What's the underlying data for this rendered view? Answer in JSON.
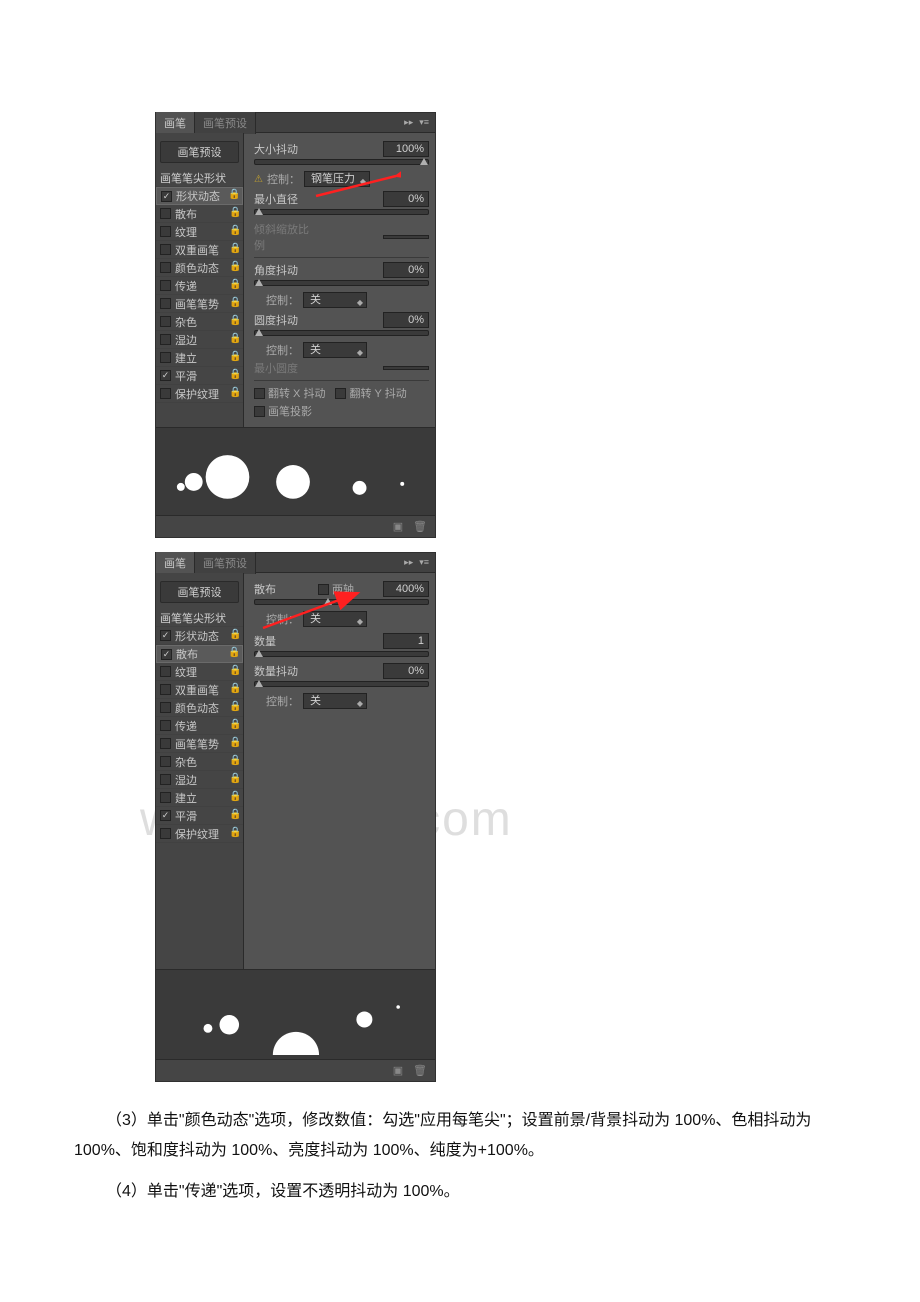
{
  "watermark": "www.bdocx.com",
  "panel1": {
    "tabs": {
      "active": "画笔",
      "inactive": "画笔预设"
    },
    "sidebar": {
      "btn": "画笔预设",
      "header": "画笔笔尖形状",
      "items": [
        {
          "label": "形状动态",
          "checked": true,
          "locked": true,
          "selected": true
        },
        {
          "label": "散布",
          "checked": false,
          "locked": true
        },
        {
          "label": "纹理",
          "checked": false,
          "locked": true
        },
        {
          "label": "双重画笔",
          "checked": false,
          "locked": true
        },
        {
          "label": "颜色动态",
          "checked": false,
          "locked": true
        },
        {
          "label": "传递",
          "checked": false,
          "locked": true
        },
        {
          "label": "画笔笔势",
          "checked": false,
          "locked": true
        },
        {
          "label": "杂色",
          "checked": false,
          "locked": true
        },
        {
          "label": "湿边",
          "checked": false,
          "locked": true
        },
        {
          "label": "建立",
          "checked": false,
          "locked": true
        },
        {
          "label": "平滑",
          "checked": true,
          "locked": true
        },
        {
          "label": "保护纹理",
          "checked": false,
          "locked": true
        }
      ]
    },
    "content": {
      "size_jitter_label": "大小抖动",
      "size_jitter_value": "100%",
      "control_label": "控制：",
      "control_dropdown": "钢笔压力",
      "min_diameter_label": "最小直径",
      "min_diameter_value": "0%",
      "tilt_scale_label": "倾斜缩放比例",
      "angle_jitter_label": "角度抖动",
      "angle_jitter_value": "0%",
      "angle_control_label": "控制：",
      "angle_control_value": "关",
      "round_jitter_label": "圆度抖动",
      "round_jitter_value": "0%",
      "round_control_label": "控制：",
      "round_control_value": "关",
      "min_round_label": "最小圆度",
      "flip_x_label": "翻转 X 抖动",
      "flip_y_label": "翻转 Y 抖动",
      "brush_proj_label": "画笔投影"
    }
  },
  "panel2": {
    "tabs": {
      "active": "画笔",
      "inactive": "画笔预设"
    },
    "sidebar": {
      "btn": "画笔预设",
      "header": "画笔笔尖形状",
      "items": [
        {
          "label": "形状动态",
          "checked": true,
          "locked": true
        },
        {
          "label": "散布",
          "checked": true,
          "locked": true,
          "lockred": true,
          "selected": true
        },
        {
          "label": "纹理",
          "checked": false,
          "locked": true
        },
        {
          "label": "双重画笔",
          "checked": false,
          "locked": true
        },
        {
          "label": "颜色动态",
          "checked": false,
          "locked": true
        },
        {
          "label": "传递",
          "checked": false,
          "locked": true
        },
        {
          "label": "画笔笔势",
          "checked": false,
          "locked": true
        },
        {
          "label": "杂色",
          "checked": false,
          "locked": true
        },
        {
          "label": "湿边",
          "checked": false,
          "locked": true
        },
        {
          "label": "建立",
          "checked": false,
          "locked": true
        },
        {
          "label": "平滑",
          "checked": true,
          "locked": true
        },
        {
          "label": "保护纹理",
          "checked": false,
          "locked": true
        }
      ]
    },
    "content": {
      "scatter_label": "散布",
      "both_axes_label": "两轴",
      "scatter_value": "400%",
      "control_label": "控制：",
      "control_value": "关",
      "count_label": "数量",
      "count_value": "1",
      "count_jitter_label": "数量抖动",
      "count_jitter_value": "0%",
      "count_control_label": "控制：",
      "count_control_value": "关"
    }
  },
  "body_text": {
    "p1": "（3）单击\"颜色动态\"选项，修改数值：勾选\"应用每笔尖\"；设置前景/背景抖动为 100%、色相抖动为 100%、饱和度抖动为 100%、亮度抖动为 100%、纯度为+100%。",
    "p2": "（4）单击\"传递\"选项，设置不透明抖动为 100%。"
  },
  "icons": {
    "expand": "▸▸",
    "menu": "▾≡",
    "lock": "🔒",
    "new": "▣",
    "trash": "🗑",
    "warn": "⚠"
  }
}
